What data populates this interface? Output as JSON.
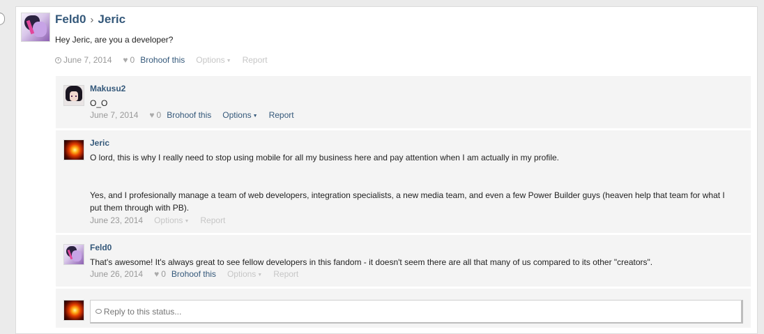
{
  "status": {
    "author": "Feld0",
    "separator": "›",
    "target": "Jeric",
    "text": "Hey Jeric, are you a developer?",
    "date": "June 7, 2014",
    "likes": "0",
    "brohoof_label": "Brohoof this",
    "options_label": "Options",
    "report_label": "Report"
  },
  "comments": [
    {
      "author": "Makusu2",
      "text": "O_O",
      "date": "June 7, 2014",
      "likes": "0",
      "brohoof_label": "Brohoof this",
      "options_label": "Options",
      "report_label": "Report"
    },
    {
      "author": "Jeric",
      "text_p1": "O lord, this is why I really need to stop using mobile for all my business here and pay attention when I am actually in my profile.",
      "text_p2": "Yes, and I profesionally manage a team of web developers, integration specialists, a new media team, and even a few Power Builder guys (heaven help that team for what I put them through with PB).",
      "date": "June 23, 2014",
      "options_label": "Options",
      "report_label": "Report"
    },
    {
      "author": "Feld0",
      "text": "That's awesome! It's always great to see fellow developers in this fandom - it doesn't seem there are all that many of us compared to its other \"creators\".",
      "date": "June 26, 2014",
      "likes": "0",
      "brohoof_label": "Brohoof this",
      "options_label": "Options",
      "report_label": "Report"
    }
  ],
  "reply": {
    "placeholder": "Reply to this status..."
  },
  "icons": {
    "like": "heart-icon",
    "time": "clock-icon",
    "dropdown": "caret-down-icon",
    "reply": "speech-bubble-icon"
  }
}
